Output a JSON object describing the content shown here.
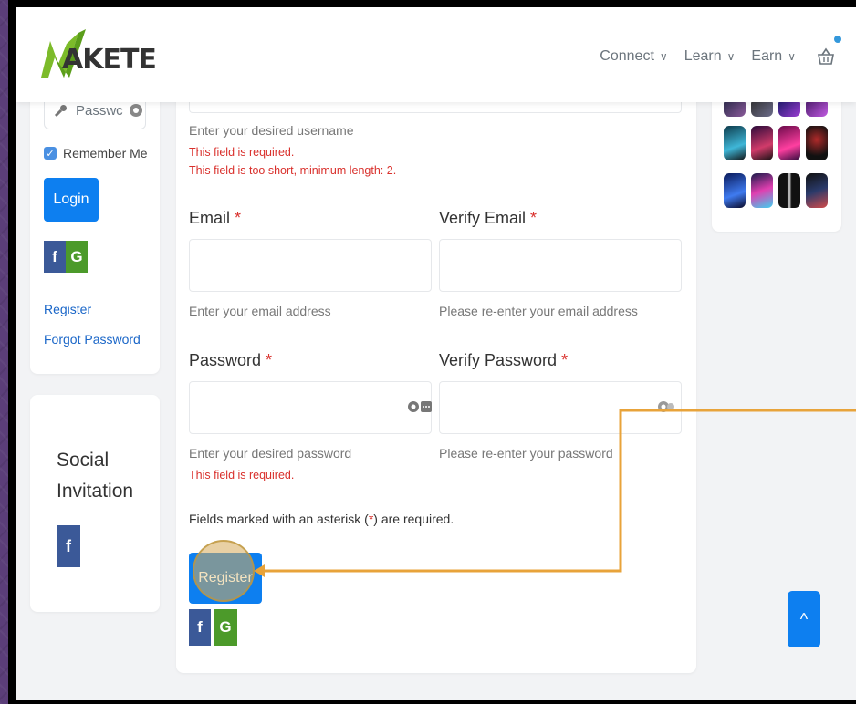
{
  "header": {
    "logo_text": "AKETE",
    "nav": [
      {
        "label": "Connect",
        "chevron": "∨"
      },
      {
        "label": "Learn",
        "chevron": "∨"
      },
      {
        "label": "Earn",
        "chevron": "∨"
      }
    ]
  },
  "login": {
    "password_placeholder": "Passwc",
    "remember_label": "Remember Me",
    "login_label": "Login",
    "facebook": "f",
    "google": "G",
    "register_link": "Register",
    "forgot_link": "Forgot Password"
  },
  "social": {
    "title_line1": "Social",
    "title_line2": "Invitation",
    "facebook": "f"
  },
  "form": {
    "username_help": "Enter your desired username",
    "username_error1": "This field is required.",
    "username_error2": "This field is too short, minimum length: 2.",
    "email_label": "Email",
    "verify_email_label": "Verify Email",
    "email_help": "Enter your email address",
    "verify_email_help": "Please re-enter your email address",
    "password_label": "Password",
    "verify_password_label": "Verify Password",
    "password_help": "Enter your desired password",
    "password_error": "This field is required.",
    "verify_password_help": "Please re-enter your password",
    "asterisk": "*",
    "required_note_prefix": "Fields marked with an asterisk (",
    "required_note_suffix": ") are required.",
    "register_label": "Register",
    "facebook": "f",
    "google": "G"
  },
  "scroll_top_label": "^",
  "colors": {
    "accent": "#0d7ff0",
    "error": "#d9302c",
    "highlight": "#e8a33a"
  }
}
